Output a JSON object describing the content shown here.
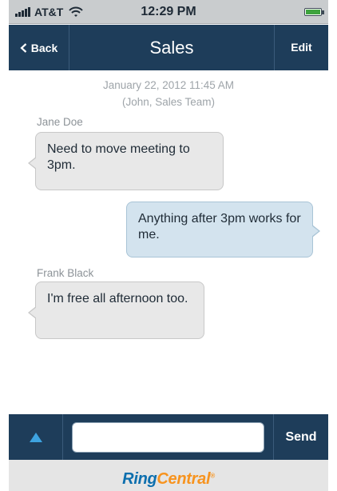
{
  "status_bar": {
    "carrier": "AT&T",
    "time": "12:29 PM",
    "signal_icon": "signal-bars-icon",
    "wifi_icon": "wifi-icon",
    "battery_icon": "battery-icon",
    "battery_level": 1.0
  },
  "nav": {
    "back_label": "Back",
    "title": "Sales",
    "edit_label": "Edit"
  },
  "conversation": {
    "timestamp": "January 22, 2012 11:45 AM",
    "participants": "(John, Sales Team)",
    "messages": [
      {
        "sender": "Jane Doe",
        "text": "Need to move meeting to 3pm.",
        "direction": "incoming"
      },
      {
        "sender": "",
        "text": "Anything after 3pm works for me.",
        "direction": "outgoing"
      },
      {
        "sender": "Frank Black",
        "text": "I'm free all afternoon too.",
        "direction": "incoming"
      }
    ]
  },
  "composer": {
    "expand_icon": "triangle-up-icon",
    "input_value": "",
    "input_placeholder": "",
    "send_label": "Send"
  },
  "footer": {
    "logo_part1": "Ring",
    "logo_part2": "Central"
  },
  "colors": {
    "nav_background": "#1e3d5a",
    "accent": "#3ea3e0",
    "incoming_bubble": "#e8e8e8",
    "outgoing_bubble": "#d3e3ee",
    "logo_blue": "#0d6fae",
    "logo_orange": "#f7931e"
  }
}
